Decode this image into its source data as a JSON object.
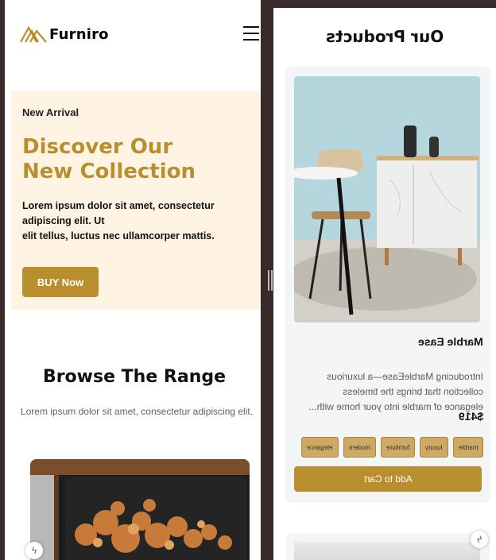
{
  "brand": {
    "name": "Furniro",
    "logo_icon": "furniro-logo-icon",
    "accent": "#b88e2f"
  },
  "header": {
    "menu_icon": "hamburger-menu-icon"
  },
  "hero": {
    "subtitle": "New Arrival",
    "title_line1": "Discover Our",
    "title_line2": "New Collection",
    "description": "Lorem ipsum dolor sit amet, consectetur adipiscing elit. Ut\nelit tellus, luctus nec ullamcorper mattis.",
    "button_label": "BUY Now",
    "background": "#fff3e3"
  },
  "browse": {
    "title": "Browse The Range",
    "description": "Lorem ipsum dolor sit amet, consectetur adipiscing elit."
  },
  "products": {
    "title": "Our Products",
    "items": [
      {
        "name": "Marble Ease",
        "description": "Introducing MarbleEase—a luxurious\ncollection that brings the timeless\nelegance of marble into your home with...",
        "price": "$419",
        "tags": [
          "marble",
          "luxury",
          "furniture",
          "modern",
          "elegance"
        ],
        "button_label": "Add to Cart"
      }
    ]
  },
  "icons": {
    "fab": "lightning-icon"
  }
}
